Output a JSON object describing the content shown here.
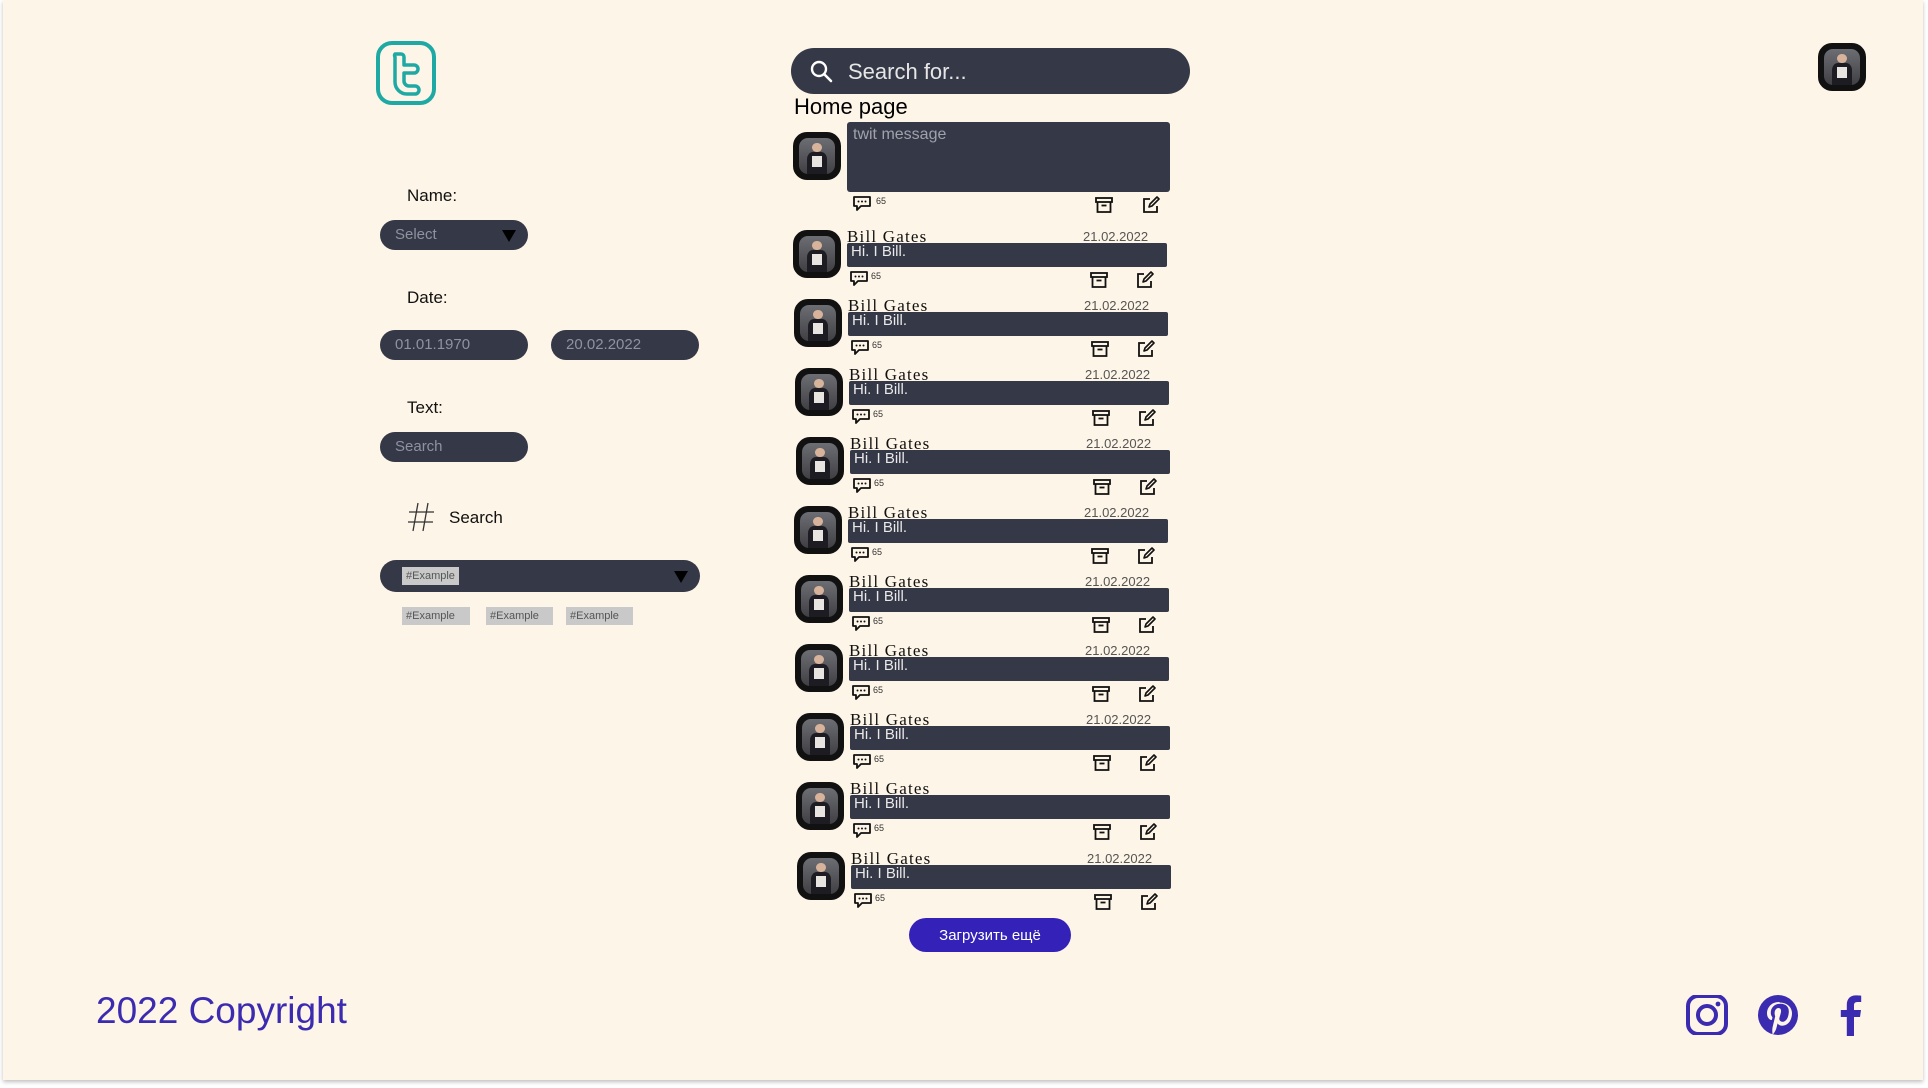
{
  "search": {
    "placeholder": "Search for..."
  },
  "page_title": "Home page",
  "compose": {
    "placeholder": "twit message",
    "count": "65"
  },
  "filters": {
    "name_label": "Name:",
    "name_select": "Select",
    "date_label": "Date:",
    "date_from": "01.01.1970",
    "date_to": "20.02.2022",
    "text_label": "Text:",
    "text_placeholder": "Search",
    "hashtag_label": "Search",
    "hashtag_selected": "#Example",
    "hashtag_tags": [
      "#Example",
      "#Example",
      "#Example"
    ]
  },
  "tweets": [
    {
      "author": "Bill Gates",
      "date": "21.02.2022",
      "text": "Hi. I Bill.",
      "count": "65"
    },
    {
      "author": "Bill Gates",
      "date": "21.02.2022",
      "text": "Hi. I Bill.",
      "count": "65"
    },
    {
      "author": "Bill Gates",
      "date": "21.02.2022",
      "text": "Hi. I Bill.",
      "count": "65"
    },
    {
      "author": "Bill Gates",
      "date": "21.02.2022",
      "text": "Hi. I Bill.",
      "count": "65"
    },
    {
      "author": "Bill Gates",
      "date": "21.02.2022",
      "text": "Hi. I Bill.",
      "count": "65"
    },
    {
      "author": "Bill Gates",
      "date": "21.02.2022",
      "text": "Hi. I Bill.",
      "count": "65"
    },
    {
      "author": "Bill Gates",
      "date": "21.02.2022",
      "text": "Hi. I Bill.",
      "count": "65"
    },
    {
      "author": "Bill Gates",
      "date": "21.02.2022",
      "text": "Hi. I Bill.",
      "count": "65"
    },
    {
      "author": "Bill Gates",
      "date": "",
      "text": "Hi. I Bill.",
      "count": "65"
    },
    {
      "author": "Bill Gates",
      "date": "21.02.2022",
      "text": "Hi. I Bill.",
      "count": "65"
    }
  ],
  "load_more": "Загрузить ещё",
  "footer": {
    "copyright": "2022 Copyright"
  },
  "icons": {
    "logo": "twitter-logo-icon",
    "search": "search-icon",
    "hashtag": "hashtag-icon",
    "comment": "comment-icon",
    "archive": "archive-icon",
    "edit": "edit-icon",
    "social": [
      "instagram-icon",
      "pinterest-icon",
      "facebook-icon"
    ]
  },
  "colors": {
    "background": "#fdf5e7",
    "dark_surface": "#353846",
    "accent": "#3422b8",
    "logo": "#1fa9a4"
  }
}
